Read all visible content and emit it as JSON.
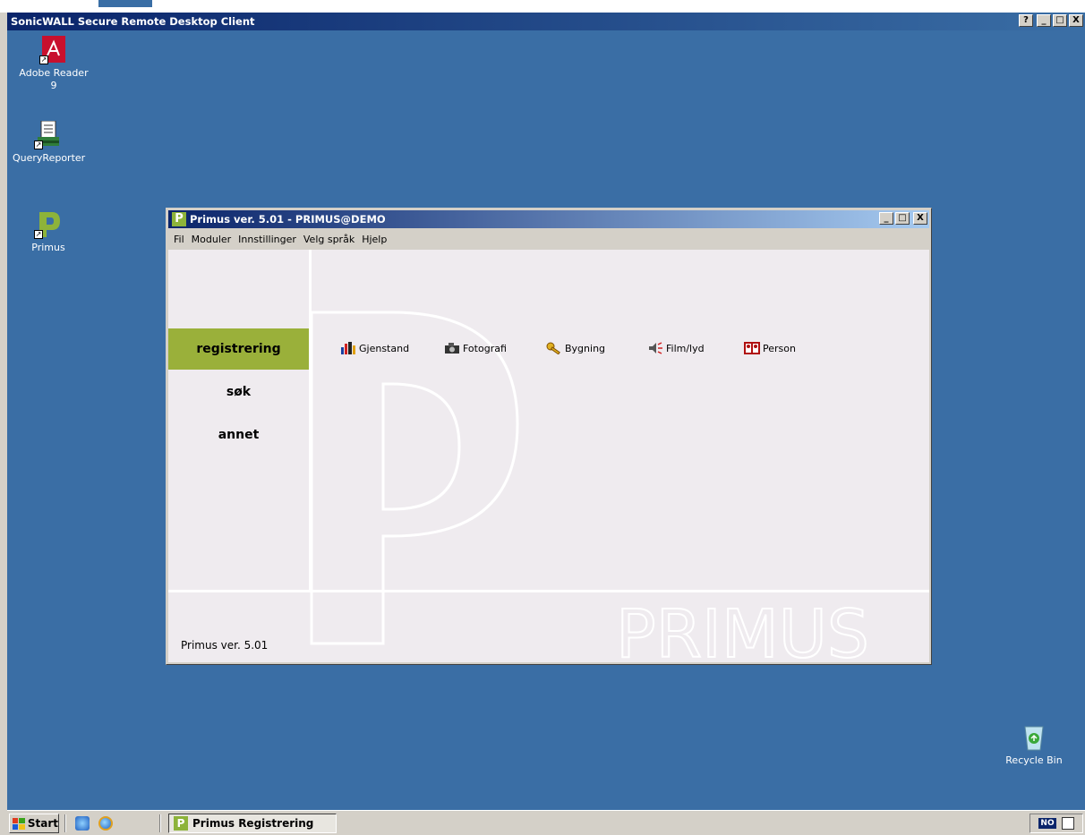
{
  "rdp_window": {
    "title": "SonicWALL Secure Remote Desktop Client",
    "help_label": "?",
    "min_label": "_",
    "max_label": "□",
    "close_label": "X"
  },
  "desktop_icons": [
    {
      "label": "Adobe Reader 9",
      "icon": "adobe-reader-icon"
    },
    {
      "label": "QueryReporter",
      "icon": "query-reporter-icon"
    },
    {
      "label": "Primus",
      "icon": "primus-icon"
    }
  ],
  "recycle_bin": {
    "label": "Recycle Bin"
  },
  "primus_window": {
    "title": "Primus ver. 5.01 - PRIMUS@DEMO",
    "logo_letter": "P",
    "menu": [
      "Fil",
      "Moduler",
      "Innstillinger",
      "Velg språk",
      "Hjelp"
    ],
    "side_nav": [
      {
        "label": "registrering",
        "active": true
      },
      {
        "label": "søk",
        "active": false
      },
      {
        "label": "annet",
        "active": false
      }
    ],
    "modules": [
      {
        "label": "Gjenstand",
        "icon": "gjenstand-icon"
      },
      {
        "label": "Fotografi",
        "icon": "camera-icon"
      },
      {
        "label": "Bygning",
        "icon": "key-icon"
      },
      {
        "label": "Film/lyd",
        "icon": "speaker-icon"
      },
      {
        "label": "Person",
        "icon": "person-icon"
      }
    ],
    "status_text": "Primus ver. 5.01",
    "watermark_text": "PRIMUS",
    "accent_color": "#9ab03a"
  },
  "taskbar": {
    "start_label": "Start",
    "task_label": "Primus Registrering",
    "lang_label": "NO"
  }
}
